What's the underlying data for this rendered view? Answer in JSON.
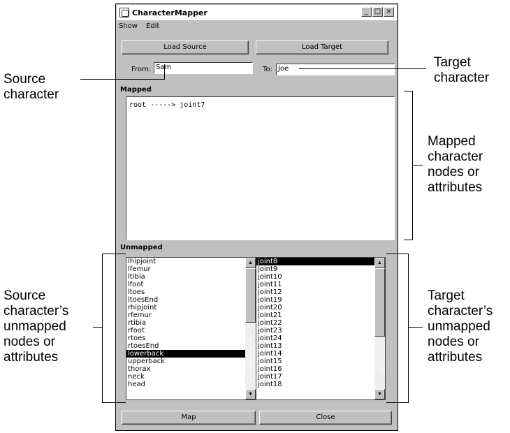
{
  "window": {
    "title": "CharacterMapper"
  },
  "titlebar_buttons": {
    "minimize": "_",
    "maximize": "□",
    "close": "×"
  },
  "menu": [
    "Show",
    "Edit"
  ],
  "buttons": {
    "load_source": "Load Source",
    "load_target": "Load Target",
    "map": "Map",
    "close": "Close"
  },
  "from": {
    "label": "From:",
    "value": "Sam"
  },
  "to": {
    "label": "To:",
    "value": "Joe"
  },
  "mapped": {
    "header": "Mapped",
    "lines": [
      "root -----> joint7"
    ]
  },
  "unmapped": {
    "header": "Unmapped",
    "source_items": [
      "lhipjoint",
      "lfemur",
      "ltibia",
      "lfoot",
      "ltoes",
      "ltoesEnd",
      "rhipjoint",
      "rfemur",
      "rtibia",
      "rfoot",
      "rtoes",
      "rtoesEnd",
      "lowerback",
      "upperback",
      "thorax",
      "neck",
      "head"
    ],
    "source_selected": "lowerback",
    "target_items": [
      "joint8",
      "joint9",
      "joint10",
      "joint11",
      "joint12",
      "joint19",
      "joint20",
      "joint21",
      "joint22",
      "joint23",
      "joint24",
      "joint13",
      "joint14",
      "joint15",
      "joint16",
      "joint17",
      "joint18"
    ],
    "target_selected": "joint8"
  },
  "callouts": {
    "source_character": [
      "Source",
      "character"
    ],
    "target_character": [
      "Target",
      "character"
    ],
    "mapped_nodes": [
      "Mapped",
      "character",
      "nodes or",
      "attributes"
    ],
    "source_unmapped": [
      "Source",
      "character’s",
      "unmapped",
      "nodes or",
      "attributes"
    ],
    "target_unmapped": [
      "Target",
      "character’s",
      "unmapped",
      "nodes or",
      "attributes"
    ]
  }
}
